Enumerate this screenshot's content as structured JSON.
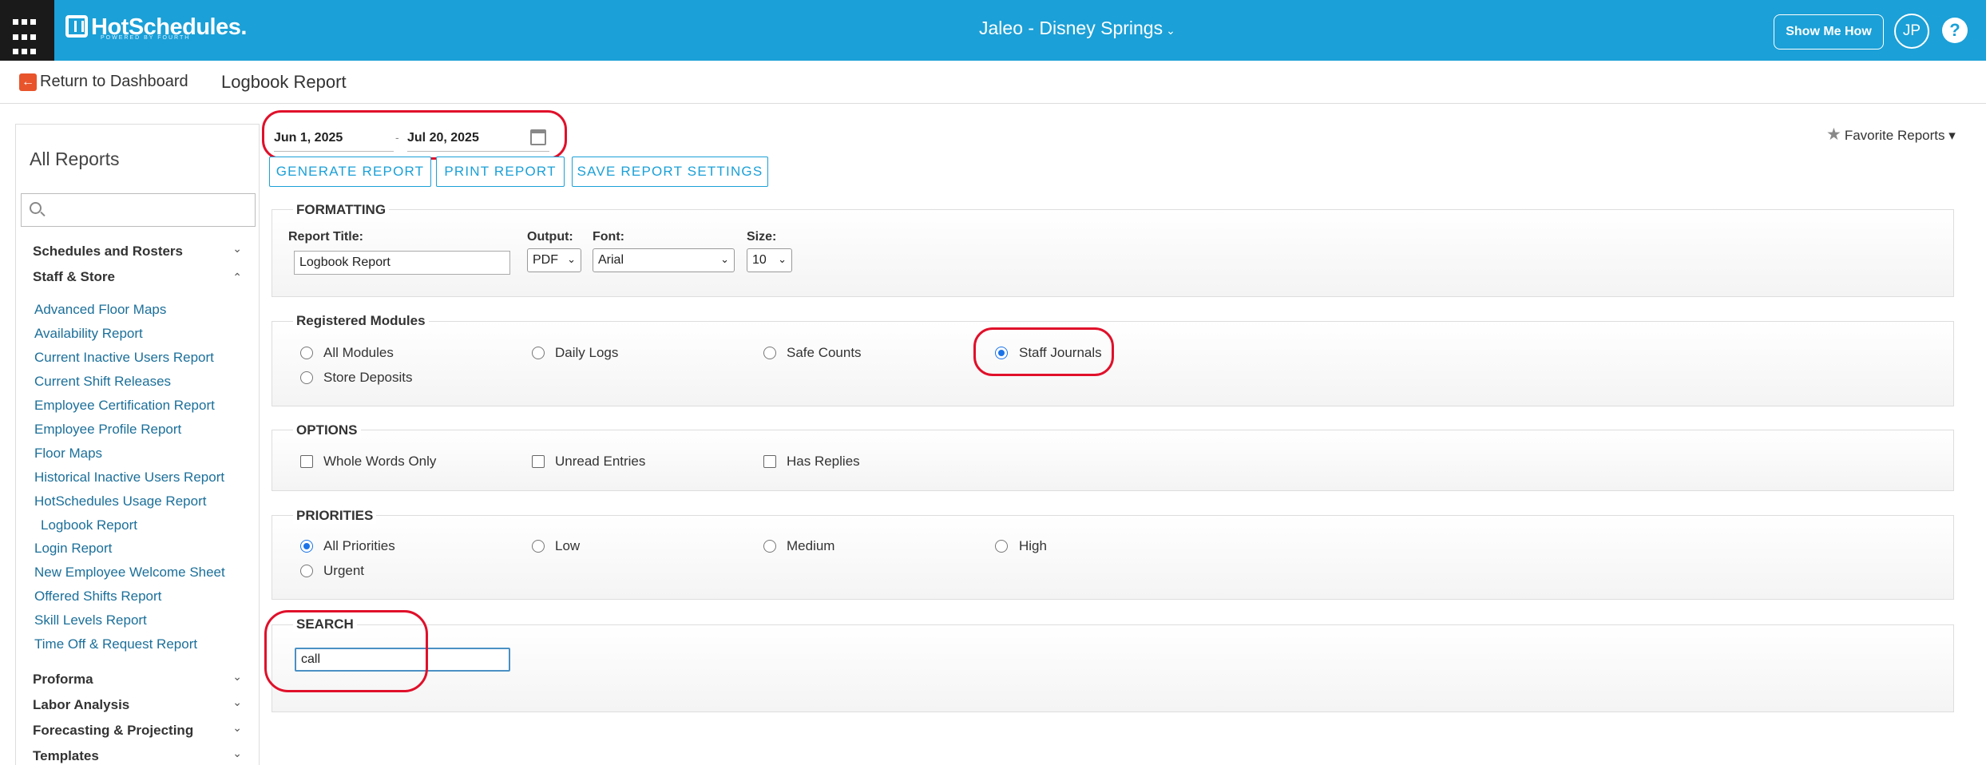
{
  "header": {
    "logo_text": "HotSchedules.",
    "logo_subtext": "POWERED BY FOURTH",
    "location": "Jaleo - Disney Springs",
    "show_me_how": "Show Me How",
    "user_initials": "JP",
    "help_symbol": "?"
  },
  "subheader": {
    "return_label": "Return to Dashboard",
    "page_title": "Logbook Report"
  },
  "sidebar": {
    "title": "All Reports",
    "search_placeholder": "",
    "categories": [
      {
        "label": "Schedules and Rosters",
        "expanded": false
      },
      {
        "label": "Staff & Store",
        "expanded": true
      },
      {
        "label": "Proforma",
        "expanded": false
      },
      {
        "label": "Labor Analysis",
        "expanded": false
      },
      {
        "label": "Forecasting & Projecting",
        "expanded": false
      },
      {
        "label": "Templates",
        "expanded": false
      }
    ],
    "links": [
      "Advanced Floor Maps",
      "Availability Report",
      "Current Inactive Users Report",
      "Current Shift Releases",
      "Employee Certification Report",
      "Employee Profile Report",
      "Floor Maps",
      "Historical Inactive Users Report",
      "HotSchedules Usage Report",
      "Logbook Report",
      "Login Report",
      "New Employee Welcome Sheet",
      "Offered Shifts Report",
      "Skill Levels Report",
      "Time Off & Request Report"
    ],
    "active_link": "Logbook Report"
  },
  "date_range": {
    "start": "Jun 1, 2025",
    "separator": "-",
    "end": "Jul 20, 2025"
  },
  "actions": {
    "generate": "GENERATE REPORT",
    "print": "PRINT REPORT",
    "save": "SAVE REPORT SETTINGS"
  },
  "favorite_reports": "Favorite Reports",
  "formatting": {
    "legend": "FORMATTING",
    "report_title_label": "Report Title:",
    "report_title_value": "Logbook Report",
    "output_label": "Output:",
    "output_value": "PDF",
    "font_label": "Font:",
    "font_value": "Arial",
    "size_label": "Size:",
    "size_value": "10"
  },
  "modules": {
    "legend": "Registered Modules",
    "options": [
      "All Modules",
      "Daily Logs",
      "Safe Counts",
      "Staff Journals",
      "Store Deposits"
    ],
    "selected": "Staff Journals"
  },
  "options": {
    "legend": "OPTIONS",
    "items": [
      "Whole Words Only",
      "Unread Entries",
      "Has Replies"
    ]
  },
  "priorities": {
    "legend": "PRIORITIES",
    "options": [
      "All Priorities",
      "Low",
      "Medium",
      "High",
      "Urgent"
    ],
    "selected": "All Priorities"
  },
  "search": {
    "legend": "SEARCH",
    "value": "call"
  },
  "colors": {
    "brand": "#1ba0d7",
    "highlight": "#e0102a",
    "link": "#1b6f9a"
  }
}
